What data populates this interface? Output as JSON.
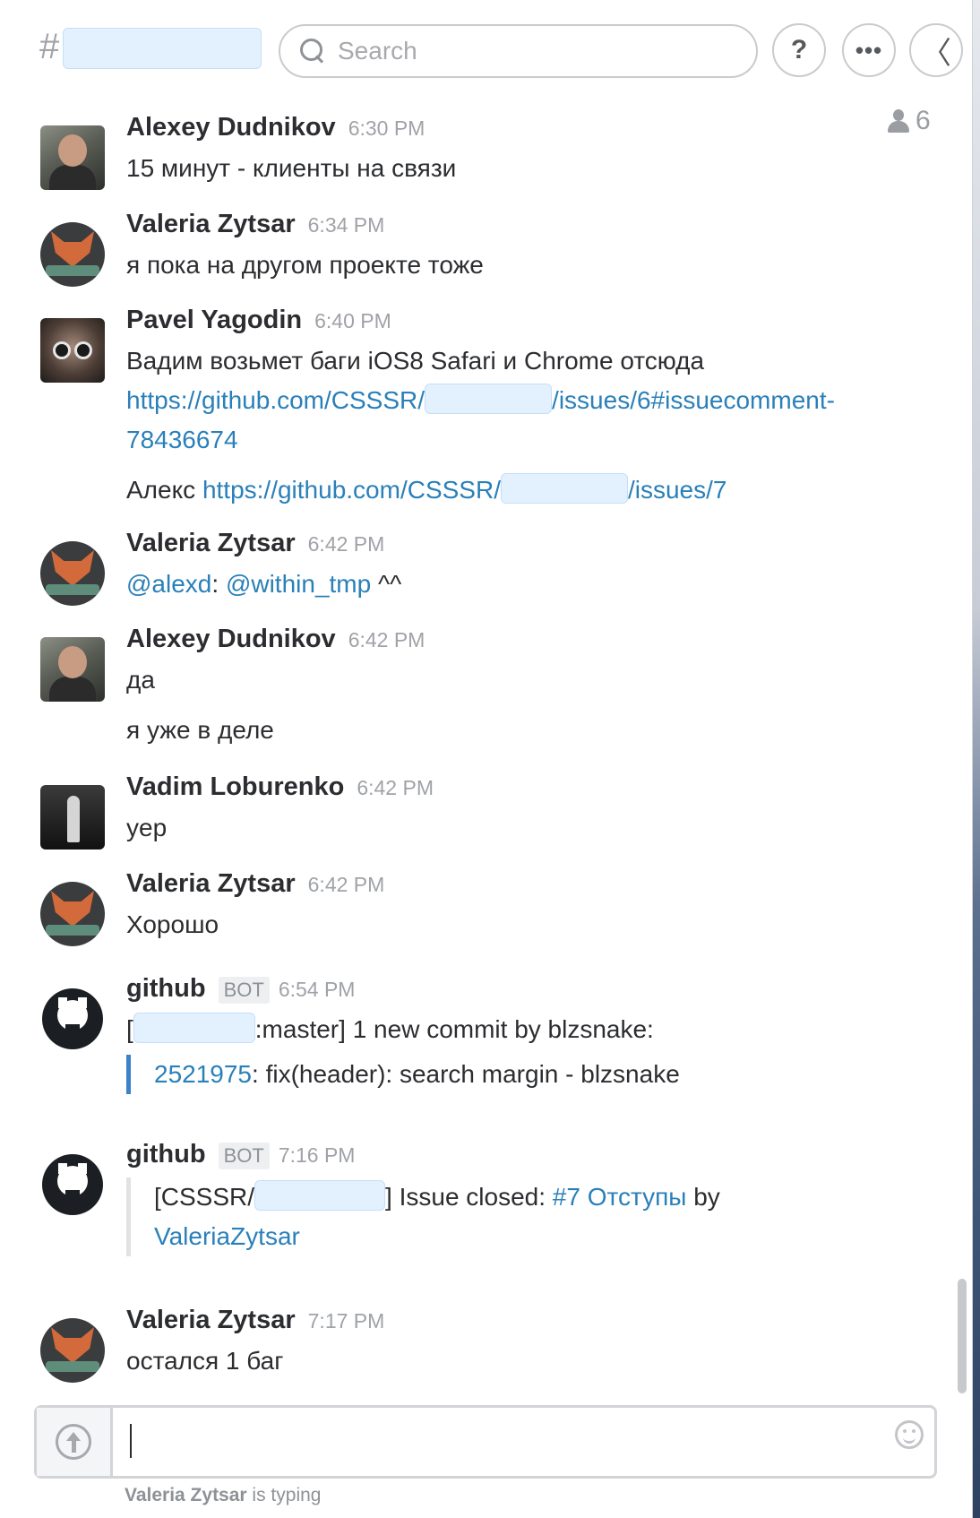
{
  "header": {
    "hash": "#",
    "search_placeholder": "Search",
    "help_label": "?",
    "more_label": "•••",
    "back_label": "〈",
    "member_count": "6"
  },
  "messages": [
    {
      "author": "Alexey Dudnikov",
      "time": "6:30 PM",
      "text": "15 минут - клиенты на связи"
    },
    {
      "author": "Valeria Zytsar",
      "time": "6:34 PM",
      "text": "я пока на другом проекте тоже"
    },
    {
      "author": "Pavel Yagodin",
      "time": "6:40 PM",
      "text": "Вадим возьмет баги  iOS8 Safari и Chrome отсюда",
      "link1_prefix": "https://github.com/CSSSR/",
      "link1_suffix": "/issues/6#issuecomment-",
      "link1_tail": "78436674",
      "line2_text": "Алекс ",
      "link2_prefix": "https://github.com/CSSSR/",
      "link2_suffix": "/issues/7"
    },
    {
      "author": "Valeria Zytsar",
      "time": "6:42 PM",
      "mention1": "@alexd",
      "colon": ": ",
      "mention2": "@within_tmp",
      "tail": " ^^"
    },
    {
      "author": "Alexey Dudnikov",
      "time": "6:42 PM",
      "text": "да",
      "text2": "я уже в деле"
    },
    {
      "author": "Vadim Loburenko",
      "time": "6:42 PM",
      "text": "yep"
    },
    {
      "author": "Valeria Zytsar",
      "time": "6:42 PM",
      "text": "Хорошо"
    },
    {
      "author": "github",
      "badge": "BOT",
      "time": "6:54 PM",
      "text_open": "[",
      "text_rest": ":master] 1 new commit by blzsnake:",
      "commit_hash": "2521975",
      "commit_text": ": fix(header): search margin - blzsnake"
    },
    {
      "author": "github",
      "badge": "BOT",
      "time": "7:16 PM",
      "prefix": "[CSSSR/",
      "middle": "] Issue closed: ",
      "issue_link": "#7 Отступы",
      "by": " by",
      "user_link": "ValeriaZytsar"
    },
    {
      "author": "Valeria Zytsar",
      "time": "7:17 PM",
      "text": "остался 1 баг"
    }
  ],
  "footer": {
    "typing_user": "Valeria Zytsar",
    "typing_text": " is typing"
  },
  "colors": {
    "link": "#2a80b9",
    "redaction": "#e3f1ff",
    "commit_bar": "#3c82c8"
  }
}
